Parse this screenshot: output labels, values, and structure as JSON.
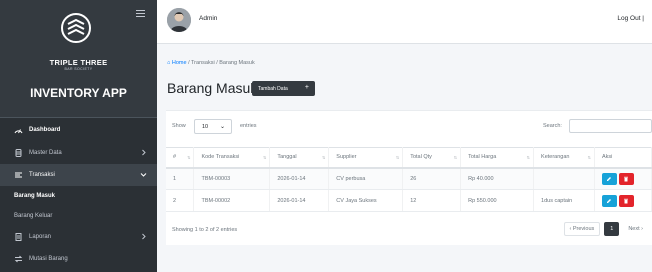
{
  "sidebar": {
    "brand_name": "TRIPLE THREE",
    "brand_sub": "BAR SOCIETY",
    "app_name": "INVENTORY APP",
    "menu": [
      {
        "label": "Dashboard",
        "icon": "dashboard-icon"
      },
      {
        "label": "Master Data",
        "icon": "database-icon"
      },
      {
        "label": "Transaksi",
        "icon": "list-icon"
      },
      {
        "label": "Barang Masuk"
      },
      {
        "label": "Barang Keluar"
      },
      {
        "label": "Laporan",
        "icon": "file-icon"
      },
      {
        "label": "Mutasi Barang",
        "icon": "swap-icon"
      }
    ]
  },
  "topbar": {
    "user": "Admin",
    "logout": "Log Out |"
  },
  "breadcrumb": {
    "home": "⌂ Home",
    "sep": "/",
    "level1": "Transaksi",
    "level2": "Barang Masuk"
  },
  "page": {
    "title": "Barang Masuk",
    "add_button": "Tambah Data",
    "add_icon": "+"
  },
  "table_controls": {
    "show": "Show",
    "length_value": "10",
    "entries": "entries",
    "search": "Search:"
  },
  "table": {
    "headers": [
      "#",
      "Kode Transaksi",
      "Tanggal",
      "Supplier",
      "Total Qty",
      "Total Harga",
      "Keterangan",
      "Aksi"
    ],
    "rows": [
      {
        "no": "1",
        "kode": "TBM-00003",
        "tanggal": "2026-01-14",
        "supplier": "CV perbusa",
        "qty": "26",
        "harga": "Rp 40.000",
        "ket": ""
      },
      {
        "no": "2",
        "kode": "TBM-00002",
        "tanggal": "2026-01-14",
        "supplier": "CV Jaya Sukses",
        "qty": "12",
        "harga": "Rp 550.000",
        "ket": "1dus captain"
      }
    ]
  },
  "footer": {
    "info": "Showing 1 to 2 of 2 entries",
    "previous": "‹ Previous",
    "page": "1",
    "next": "Next ›"
  },
  "colors": {
    "sidebar": "#2b3035",
    "accent_dark": "#343a40",
    "edit": "#17a2d8",
    "delete": "#e3242b"
  }
}
